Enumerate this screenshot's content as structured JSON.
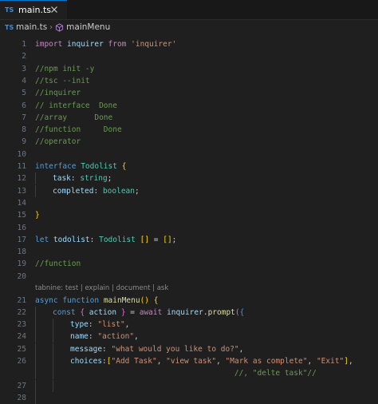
{
  "tab": {
    "badge": "TS",
    "label": "main.ts"
  },
  "breadcrumb": {
    "badge": "TS",
    "file": "main.ts",
    "symbol": "mainMenu"
  },
  "lens": {
    "text": "tabnine: test | explain | document | ask"
  },
  "lines": [
    {
      "n": "1",
      "segs": [
        [
          "kc",
          "import "
        ],
        [
          "va",
          "inquirer "
        ],
        [
          "kc",
          "from "
        ],
        [
          "str",
          "'inquirer'"
        ]
      ]
    },
    {
      "n": "2",
      "segs": []
    },
    {
      "n": "3",
      "segs": [
        [
          "cm",
          "//npm init -y"
        ]
      ]
    },
    {
      "n": "4",
      "segs": [
        [
          "cm",
          "//tsc --init"
        ]
      ]
    },
    {
      "n": "5",
      "segs": [
        [
          "cm",
          "//inquirer"
        ]
      ]
    },
    {
      "n": "6",
      "segs": [
        [
          "cm",
          "// interface  Done"
        ]
      ]
    },
    {
      "n": "7",
      "segs": [
        [
          "cm",
          "//array      Done"
        ]
      ]
    },
    {
      "n": "8",
      "segs": [
        [
          "cm",
          "//function     Done"
        ]
      ]
    },
    {
      "n": "9",
      "segs": [
        [
          "cm",
          "//operator"
        ]
      ]
    },
    {
      "n": "10",
      "segs": []
    },
    {
      "n": "11",
      "segs": [
        [
          "kw",
          "interface "
        ],
        [
          "ty",
          "Todolist "
        ],
        [
          "br1",
          "{"
        ]
      ]
    },
    {
      "n": "12",
      "indent": 1,
      "segs": [
        [
          "va",
          "task"
        ],
        [
          "pu",
          ": "
        ],
        [
          "ty",
          "string"
        ],
        [
          "pu",
          ";"
        ]
      ]
    },
    {
      "n": "13",
      "indent": 1,
      "segs": [
        [
          "va",
          "completed"
        ],
        [
          "pu",
          ": "
        ],
        [
          "ty",
          "boolean"
        ],
        [
          "pu",
          ";"
        ]
      ]
    },
    {
      "n": "14",
      "segs": []
    },
    {
      "n": "15",
      "segs": [
        [
          "br1",
          "}"
        ]
      ]
    },
    {
      "n": "16",
      "segs": []
    },
    {
      "n": "17",
      "segs": [
        [
          "kw",
          "let "
        ],
        [
          "va",
          "todolist"
        ],
        [
          "pu",
          ": "
        ],
        [
          "ty",
          "Todolist "
        ],
        [
          "br1",
          "[]"
        ],
        [
          "pu",
          " = "
        ],
        [
          "br1",
          "[]"
        ],
        [
          "pu",
          ";"
        ]
      ]
    },
    {
      "n": "18",
      "segs": []
    },
    {
      "n": "19",
      "segs": [
        [
          "cm",
          "//function"
        ]
      ]
    },
    {
      "n": "20",
      "segs": []
    },
    {
      "n": "21",
      "segs": [
        [
          "kw",
          "async "
        ],
        [
          "kw",
          "function "
        ],
        [
          "fn",
          "mainMenu"
        ],
        [
          "br1",
          "()"
        ],
        [
          "pu",
          " "
        ],
        [
          "br1",
          "{"
        ]
      ]
    },
    {
      "n": "22",
      "indent": 1,
      "segs": [
        [
          "kw",
          "const "
        ],
        [
          "br2",
          "{ "
        ],
        [
          "va",
          "action "
        ],
        [
          "br2",
          "}"
        ],
        [
          "pu",
          " = "
        ],
        [
          "kc",
          "await "
        ],
        [
          "va",
          "inquirer"
        ],
        [
          "pu",
          "."
        ],
        [
          "fn",
          "prompt"
        ],
        [
          "br2",
          "("
        ],
        [
          "br3",
          "{"
        ]
      ]
    },
    {
      "n": "23",
      "indent": 2,
      "segs": [
        [
          "va",
          "type"
        ],
        [
          "pu",
          ": "
        ],
        [
          "str",
          "\"list\""
        ],
        [
          "pu",
          ","
        ]
      ]
    },
    {
      "n": "24",
      "indent": 2,
      "segs": [
        [
          "va",
          "name"
        ],
        [
          "pu",
          ": "
        ],
        [
          "str",
          "\"action\""
        ],
        [
          "pu",
          ","
        ]
      ]
    },
    {
      "n": "25",
      "indent": 2,
      "segs": [
        [
          "va",
          "message"
        ],
        [
          "pu",
          ": "
        ],
        [
          "str",
          "\"what would you like to do?\""
        ],
        [
          "pu",
          ","
        ]
      ]
    },
    {
      "n": "26",
      "indent": 2,
      "segs": [
        [
          "va",
          "choices"
        ],
        [
          "pu",
          ":"
        ],
        [
          "br1",
          "["
        ],
        [
          "str",
          "\"Add Task\""
        ],
        [
          "pu",
          ", "
        ],
        [
          "str",
          "\"view task\""
        ],
        [
          "pu",
          ", "
        ],
        [
          "str",
          "\"Mark as complete\""
        ],
        [
          "pu",
          ", "
        ],
        [
          "str",
          "\"Exit\""
        ],
        [
          "br1",
          "]"
        ],
        [
          "pu",
          ","
        ]
      ]
    },
    {
      "n": "",
      "indent": 2,
      "segs": [
        [
          "pu",
          "                                    "
        ],
        [
          "cm",
          "//, \"delte task\"//"
        ]
      ]
    },
    {
      "n": "27",
      "indent": 2,
      "segs": []
    },
    {
      "n": "28",
      "indent": 1,
      "segs": []
    }
  ]
}
